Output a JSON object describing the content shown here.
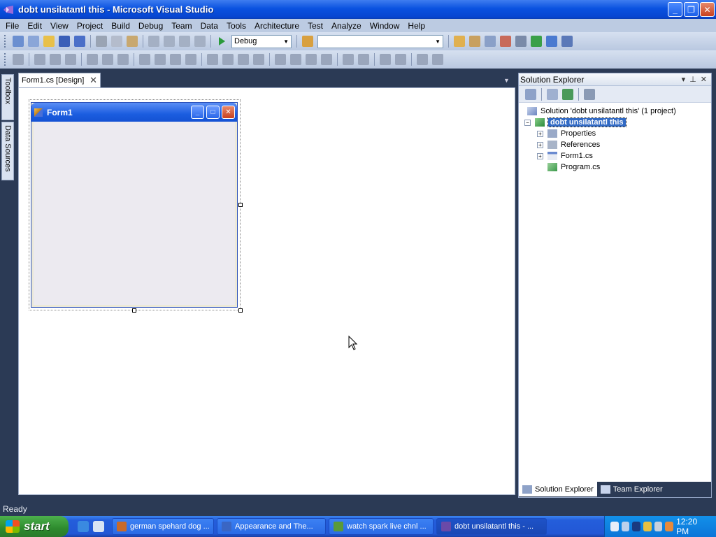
{
  "window": {
    "title": "dobt unsilatantl this - Microsoft Visual Studio",
    "controls": {
      "minimize": "_",
      "restore": "❐",
      "close": "✕"
    }
  },
  "menu": [
    "File",
    "Edit",
    "View",
    "Project",
    "Build",
    "Debug",
    "Team",
    "Data",
    "Tools",
    "Architecture",
    "Test",
    "Analyze",
    "Window",
    "Help"
  ],
  "toolbar": {
    "config_value": "Debug",
    "platform_value": ""
  },
  "side_tabs": {
    "toolbox": "Toolbox",
    "data_sources": "Data Sources"
  },
  "document_tab": {
    "label": "Form1.cs [Design]",
    "close": "✕"
  },
  "designer": {
    "form_title": "Form1",
    "form_controls": {
      "minimize": "_",
      "maximize": "□",
      "close": "✕"
    }
  },
  "solution_explorer": {
    "title": "Solution Explorer",
    "header_controls": {
      "dropdown": "▾",
      "pin": "⊥",
      "close": "✕"
    },
    "tree": {
      "solution": "Solution 'dobt unsilatantl this' (1 project)",
      "project": "dobt unsilatantl this",
      "items": [
        {
          "label": "Properties",
          "expander": "+"
        },
        {
          "label": "References",
          "expander": "+"
        },
        {
          "label": "Form1.cs",
          "expander": "+"
        },
        {
          "label": "Program.cs",
          "expander": ""
        }
      ],
      "project_expander": "−"
    },
    "bottom_tabs": [
      "Solution Explorer",
      "Team Explorer"
    ]
  },
  "status": {
    "text": "Ready"
  },
  "taskbar": {
    "start_label": "start",
    "tasks": [
      {
        "label": "german spehard dog ...",
        "icon_color": "#c86a2a"
      },
      {
        "label": "Appearance and The...",
        "icon_color": "#3a66c4"
      },
      {
        "label": "watch spark live chnl ...",
        "icon_color": "#5a9a3a"
      },
      {
        "label": "dobt unsilatantl this - ...",
        "icon_color": "#6a4aa8"
      }
    ],
    "clock": "12:20 PM"
  }
}
